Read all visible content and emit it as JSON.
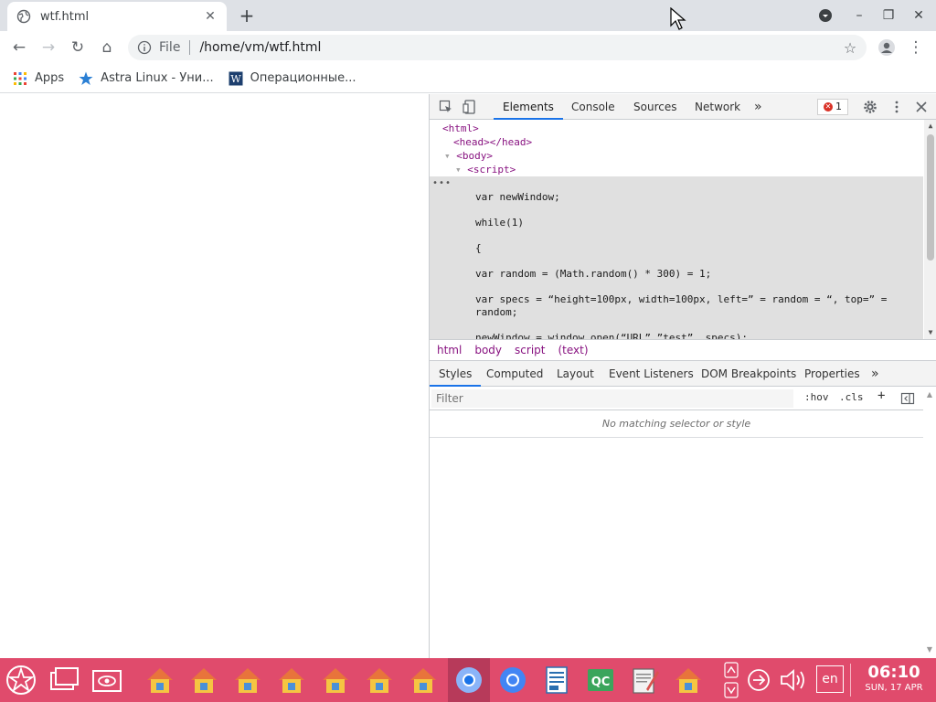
{
  "tab": {
    "title": "wtf.html",
    "close_label": "✕"
  },
  "newtab_label": "+",
  "window_controls": {
    "profile": "▾",
    "minimize": "–",
    "restore": "❐",
    "close": "✕"
  },
  "toolbar": {
    "back": "←",
    "forward": "→",
    "reload": "↻",
    "home": "⌂",
    "scheme_label": "File",
    "url": "/home/vm/wtf.html",
    "star": "☆",
    "menu": "⋮"
  },
  "bookmarks": [
    {
      "label": "Apps",
      "icon": "apps-grid-icon"
    },
    {
      "label": "Astra Linux - Уни...",
      "icon": "star-icon"
    },
    {
      "label": "Операционные...",
      "icon": "w-icon"
    }
  ],
  "devtools": {
    "tabs": [
      "Elements",
      "Console",
      "Sources",
      "Network"
    ],
    "more_tabs": "»",
    "error_count": "1",
    "dom": {
      "html_open": "<html>",
      "head": "<head></head>",
      "body_open": "<body>",
      "script_open": "<script>"
    },
    "code": [
      "var newWindow;",
      "while(1)",
      "{",
      "var random = (Math.random() * 300) = 1;",
      "var specs = “height=100px, width=100px, left=” = random = “, top=” =",
      "random;",
      "newWindow = window.open(“URL”,”test”, specs);"
    ],
    "breadcrumbs": [
      "html",
      "body",
      "script",
      "(text)"
    ],
    "sub_tabs": [
      "Styles",
      "Computed",
      "Layout",
      "Event Listeners",
      "DOM Breakpoints",
      "Properties"
    ],
    "filter_placeholder": "Filter",
    "hov": ":hov",
    "cls": ".cls",
    "add": "+",
    "no_match": "No matching selector or style"
  },
  "taskbar": {
    "lang": "en",
    "time": "06:10",
    "date": "SUN, 17 APR"
  },
  "colors": {
    "taskbar": "#e04b6c",
    "accent": "#1a73e8",
    "tag": "#881280"
  }
}
